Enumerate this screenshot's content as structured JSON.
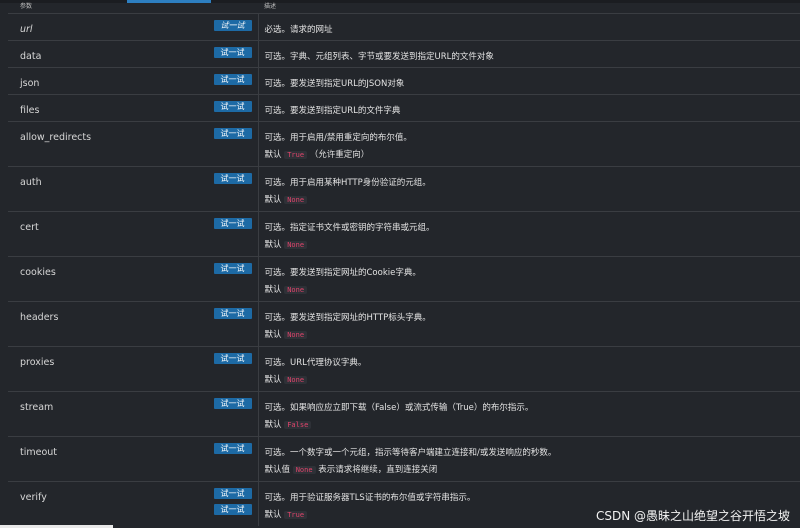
{
  "header": {
    "col_param": "参数",
    "col_desc": "描述"
  },
  "try_label": "试一试",
  "default_label": "默认",
  "rows": [
    {
      "name": "url",
      "desc": "必选。请求的网址"
    },
    {
      "name": "data",
      "desc": "可选。字典、元组列表、字节或要发送到指定URL的文件对象"
    },
    {
      "name": "json",
      "desc": "可选。要发送到指定URL的JSON对象"
    },
    {
      "name": "files",
      "desc": "可选。要发送到指定URL的文件字典"
    },
    {
      "name": "allow_redirects",
      "desc": "可选。用于启用/禁用重定向的布尔值。",
      "default": "True",
      "note": "（允许重定向）"
    },
    {
      "name": "auth",
      "desc": "可选。用于启用某种HTTP身份验证的元组。",
      "default": "None"
    },
    {
      "name": "cert",
      "desc": "可选。指定证书文件或密钥的字符串或元组。",
      "default": "None"
    },
    {
      "name": "cookies",
      "desc": "可选。要发送到指定网址的Cookie字典。",
      "default": "None"
    },
    {
      "name": "headers",
      "desc": "可选。要发送到指定网址的HTTP标头字典。",
      "default": "None"
    },
    {
      "name": "proxies",
      "desc": "可选。URL代理协议字典。",
      "default": "None"
    },
    {
      "name": "stream",
      "desc": "可选。如果响应应立即下载（False）或流式传输（True）的布尔指示。",
      "default": "False"
    },
    {
      "name": "timeout",
      "desc": "可选。一个数字或一个元组，指示等待客户端建立连接和/或发送响应的秒数。",
      "default_prefix": "默认值",
      "default": "None",
      "note": "表示请求将继续，直到连接关闭"
    },
    {
      "name": "verify",
      "desc": "可选。用于验证服务器TLS证书的布尔值或字符串指示。",
      "default": "True"
    }
  ],
  "watermark": "CSDN @愚昧之山绝望之谷开悟之坡"
}
